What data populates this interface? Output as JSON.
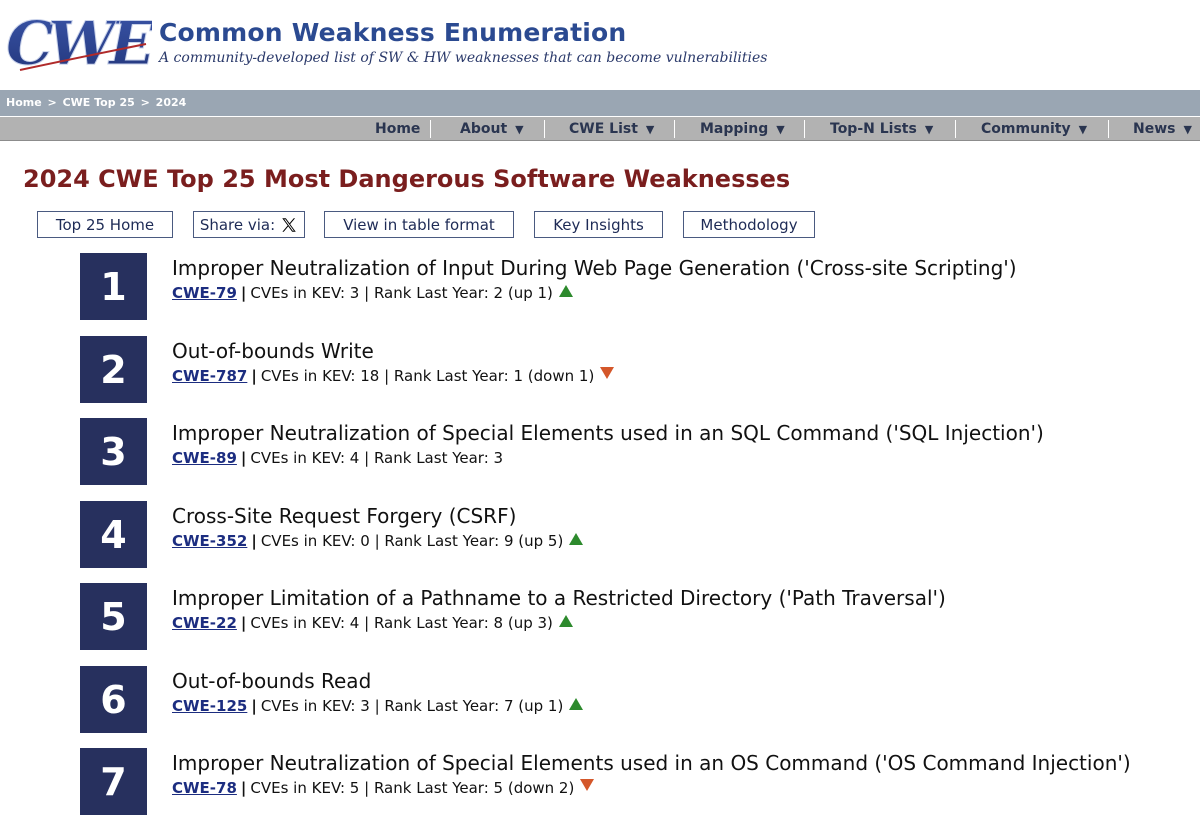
{
  "header": {
    "logo_text": "CWE",
    "site_title": "Common Weakness Enumeration",
    "tagline": "A community-developed list of SW & HW weaknesses that can become vulnerabilities"
  },
  "breadcrumb": {
    "items": [
      "Home",
      "CWE Top 25",
      "2024"
    ],
    "separator": ">"
  },
  "nav": {
    "items": [
      {
        "label": "Home",
        "dropdown": false
      },
      {
        "label": "About",
        "dropdown": true
      },
      {
        "label": "CWE List",
        "dropdown": true
      },
      {
        "label": "Mapping",
        "dropdown": true
      },
      {
        "label": "Top-N Lists",
        "dropdown": true
      },
      {
        "label": "Community",
        "dropdown": true
      },
      {
        "label": "News",
        "dropdown": true
      }
    ],
    "caret": "▼"
  },
  "page_title": "2024 CWE Top 25 Most Dangerous Software Weaknesses",
  "buttons": {
    "top25_home": "Top 25 Home",
    "share_via": "Share via:",
    "table_format": "View in table format",
    "key_insights": "Key Insights",
    "methodology": "Methodology"
  },
  "entries": [
    {
      "rank": "1",
      "title": "Improper Neutralization of Input During Web Page Generation ('Cross-site Scripting')",
      "cwe": "CWE-79",
      "kev": "CVEs in KEV: 3",
      "last_year": "Rank Last Year: 2 (up 1)",
      "trend": "up"
    },
    {
      "rank": "2",
      "title": "Out-of-bounds Write",
      "cwe": "CWE-787",
      "kev": "CVEs in KEV: 18",
      "last_year": "Rank Last Year: 1 (down 1)",
      "trend": "down"
    },
    {
      "rank": "3",
      "title": "Improper Neutralization of Special Elements used in an SQL Command ('SQL Injection')",
      "cwe": "CWE-89",
      "kev": "CVEs in KEV: 4",
      "last_year": "Rank Last Year: 3",
      "trend": "none"
    },
    {
      "rank": "4",
      "title": "Cross-Site Request Forgery (CSRF)",
      "cwe": "CWE-352",
      "kev": "CVEs in KEV: 0",
      "last_year": "Rank Last Year: 9 (up 5)",
      "trend": "up"
    },
    {
      "rank": "5",
      "title": "Improper Limitation of a Pathname to a Restricted Directory ('Path Traversal')",
      "cwe": "CWE-22",
      "kev": "CVEs in KEV: 4",
      "last_year": "Rank Last Year: 8 (up 3)",
      "trend": "up"
    },
    {
      "rank": "6",
      "title": "Out-of-bounds Read",
      "cwe": "CWE-125",
      "kev": "CVEs in KEV: 3",
      "last_year": "Rank Last Year: 7 (up 1)",
      "trend": "up"
    },
    {
      "rank": "7",
      "title": "Improper Neutralization of Special Elements used in an OS Command ('OS Command Injection')",
      "cwe": "CWE-78",
      "kev": "CVEs in KEV: 5",
      "last_year": "Rank Last Year: 5 (down 2)",
      "trend": "down"
    }
  ],
  "colors": {
    "brand_blue": "#2b4a91",
    "title_red": "#7a1e1e",
    "rank_box": "#27305e",
    "trend_up": "#2d8a2d",
    "trend_down": "#d4572a"
  }
}
